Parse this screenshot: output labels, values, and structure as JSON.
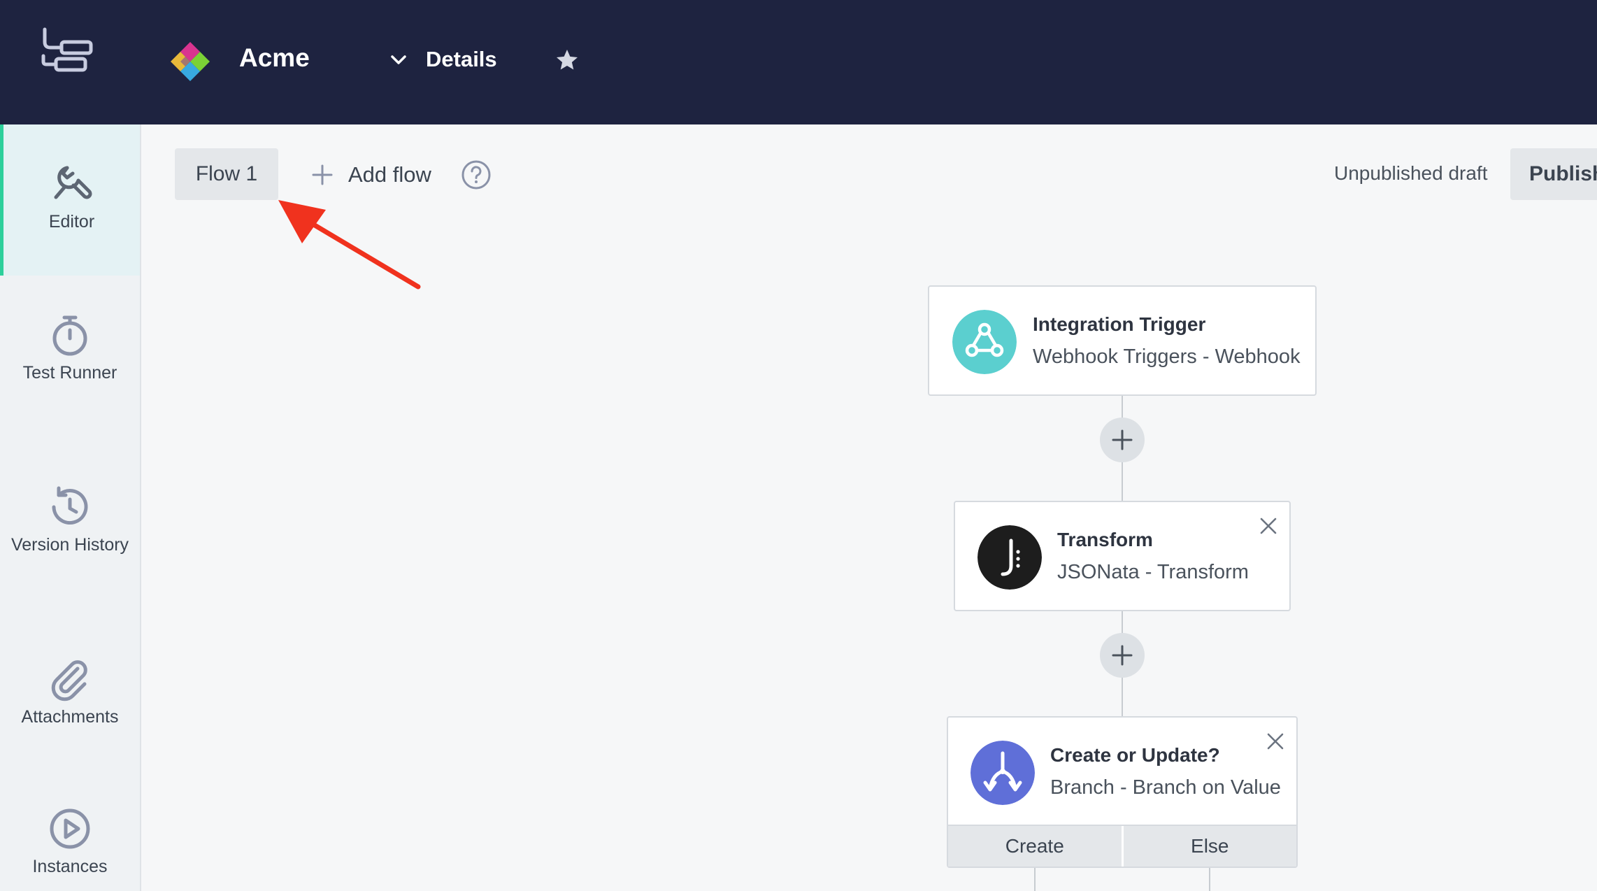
{
  "header": {
    "brand_name": "Acme",
    "details_label": "Details",
    "icons": [
      "integration-app-icon",
      "acme-diamond-logo",
      "chevron-down-icon",
      "star-icon"
    ]
  },
  "sidebar": {
    "items": [
      {
        "label": "Editor",
        "icon": "wrench-icon",
        "active": true
      },
      {
        "label": "Test Runner",
        "icon": "stopwatch-icon",
        "active": false
      },
      {
        "label": "Version History",
        "icon": "history-icon",
        "active": false
      },
      {
        "label": "Attachments",
        "icon": "paperclip-icon",
        "active": false
      },
      {
        "label": "Instances",
        "icon": "play-circle-icon",
        "active": false
      }
    ],
    "accent_color": "#2dd09b"
  },
  "toolbar": {
    "flow_tab_label": "Flow 1",
    "add_flow_label": "Add flow",
    "status_text": "Unpublished draft",
    "publish_label": "Publish"
  },
  "flow": {
    "steps": [
      {
        "title": "Integration Trigger",
        "subtitle": "Webhook Triggers - Webhook",
        "icon": "webhook-icon",
        "icon_color": "#5bcfcf"
      },
      {
        "title": "Transform",
        "subtitle": "JSONata - Transform",
        "icon": "jsonata-icon",
        "icon_color": "#1d1d1d"
      },
      {
        "title": "Create or Update?",
        "subtitle": "Branch - Branch on Value",
        "icon": "branch-icon",
        "icon_color": "#5f6fd8"
      }
    ],
    "branches": [
      "Create",
      "Else"
    ]
  },
  "colors": {
    "header_bg": "#1e2340",
    "annotation_arrow": "#f0321e"
  }
}
